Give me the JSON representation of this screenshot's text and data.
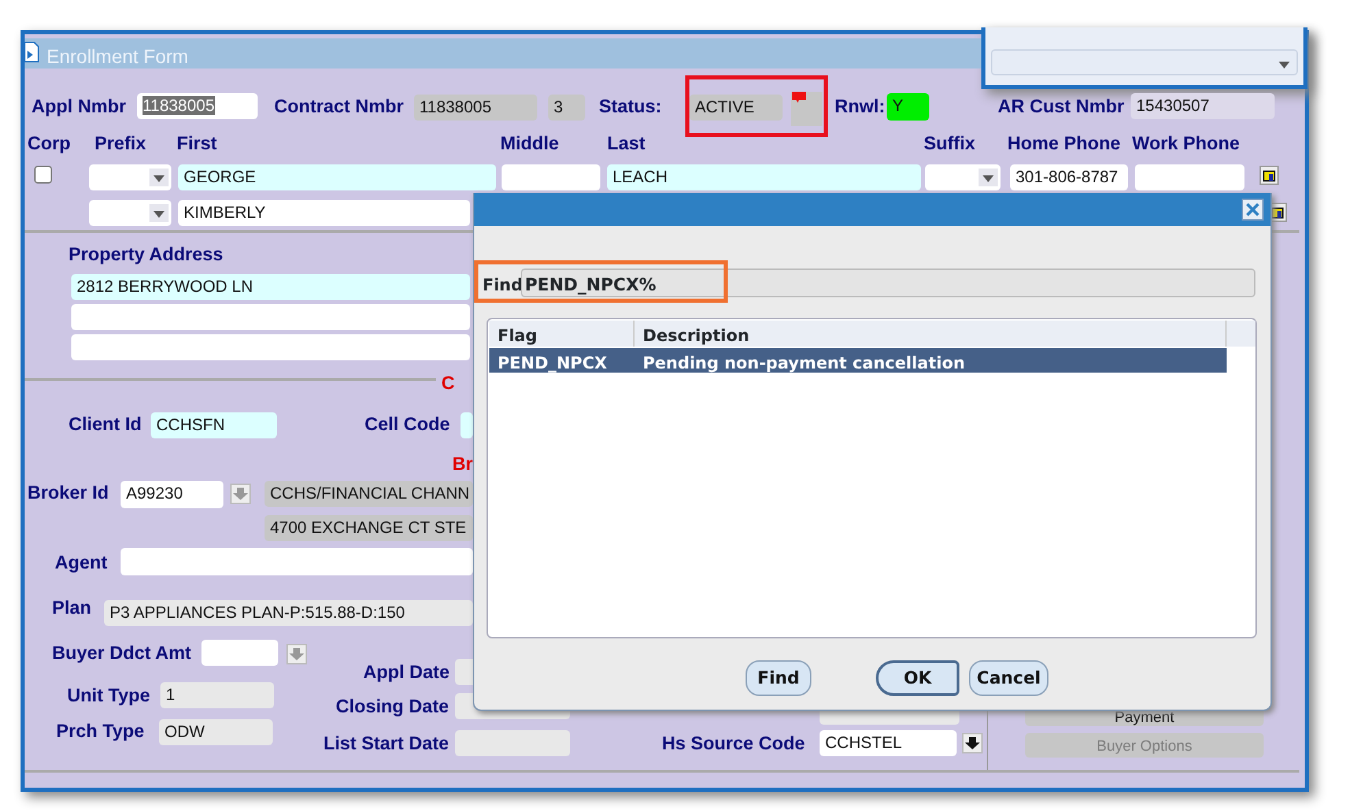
{
  "window": {
    "title": "Enrollment Form"
  },
  "header": {
    "appl_nmbr": {
      "label": "Appl Nmbr",
      "value": "11838005",
      "selected": true
    },
    "contract_nmbr": {
      "label": "Contract Nmbr",
      "value": "11838005",
      "sequence": "3"
    },
    "status": {
      "label": "Status:",
      "value": "ACTIVE"
    },
    "rnwl": {
      "label": "Rnwl:",
      "value": "Y",
      "color": "#00ee00"
    },
    "ar_cust_nmbr": {
      "label": "AR Cust Nmbr",
      "value": "15430507"
    }
  },
  "name_columns": [
    "Corp",
    "Prefix",
    "First",
    "Middle",
    "Last",
    "Suffix",
    "Home Phone",
    "Work Phone"
  ],
  "name_rows": [
    {
      "corp_checked": false,
      "first": "GEORGE",
      "first_required": true,
      "last": "LEACH",
      "home_phone": "301-806-8787"
    },
    {
      "first": "KIMBERLY",
      "first_required": false
    }
  ],
  "property_address": {
    "label": "Property Address",
    "lines": [
      {
        "value": "2812 BERRYWOOD LN",
        "kind": "required"
      },
      {
        "kind": "text"
      },
      {
        "kind": "text"
      }
    ]
  },
  "section_marks": [
    "C",
    "Br"
  ],
  "client_id": {
    "label": "Client Id",
    "value": "CCHSFN"
  },
  "cell_code": {
    "label": "Cell Code"
  },
  "broker": {
    "label": "Broker Id",
    "value": "A99230",
    "name": "CCHS/FINANCIAL CHANN",
    "address": "4700 EXCHANGE CT STE"
  },
  "agent": {
    "label": "Agent"
  },
  "plan": {
    "label": "Plan",
    "value": "P3 APPLIANCES PLAN-P:515.88-D:150"
  },
  "buyer_ddct_amt": {
    "label": "Buyer Ddct Amt"
  },
  "unit_type": {
    "label": "Unit Type",
    "value": "1"
  },
  "prch_type": {
    "label": "Prch Type",
    "value": "ODW"
  },
  "dates": [
    {
      "label": "Appl Date"
    },
    {
      "label": "Closing Date"
    },
    {
      "label": "List Start Date"
    }
  ],
  "hs_source_code": {
    "label": "Hs Source Code",
    "value": "CCHSTEL"
  },
  "side_buttons": [
    {
      "label": "Payment",
      "disabled": false
    },
    {
      "label": "Buyer Options",
      "disabled": true
    }
  ],
  "dialog": {
    "find_label": "Find",
    "find_value": "PEND_NPCX%",
    "columns": [
      "Flag",
      "Description"
    ],
    "rows": [
      {
        "flag": "PEND_NPCX",
        "description": "Pending non-payment cancellation",
        "selected": true
      }
    ],
    "buttons": [
      {
        "label": "Find",
        "default": false
      },
      {
        "label": "OK",
        "default": true
      },
      {
        "label": "Cancel",
        "default": false
      }
    ]
  },
  "annotations": [
    {
      "kind": "status",
      "color": "#e8101e"
    },
    {
      "kind": "find",
      "color": "#f07030"
    }
  ]
}
